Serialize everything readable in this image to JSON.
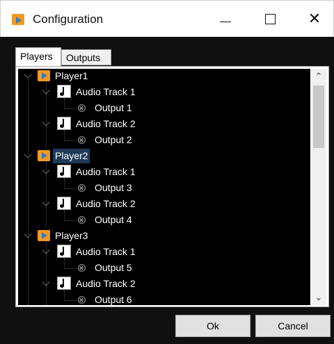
{
  "window": {
    "title": "Configuration"
  },
  "tabs": [
    {
      "label": "Players"
    },
    {
      "label": "Outputs"
    }
  ],
  "tree": {
    "players": [
      {
        "label": "Player1",
        "tracks": [
          {
            "label": "Audio Track 1",
            "output": "Output 1"
          },
          {
            "label": "Audio Track 2",
            "output": "Output 2"
          }
        ]
      },
      {
        "label": "Player2",
        "selected": true,
        "tracks": [
          {
            "label": "Audio Track 1",
            "output": "Output 3"
          },
          {
            "label": "Audio Track 2",
            "output": "Output 4"
          }
        ]
      },
      {
        "label": "Player3",
        "tracks": [
          {
            "label": "Audio Track 1",
            "output": "Output 5"
          },
          {
            "label": "Audio Track 2",
            "output": "Output 6"
          }
        ]
      }
    ]
  },
  "buttons": {
    "ok": "Ok",
    "cancel": "Cancel"
  }
}
